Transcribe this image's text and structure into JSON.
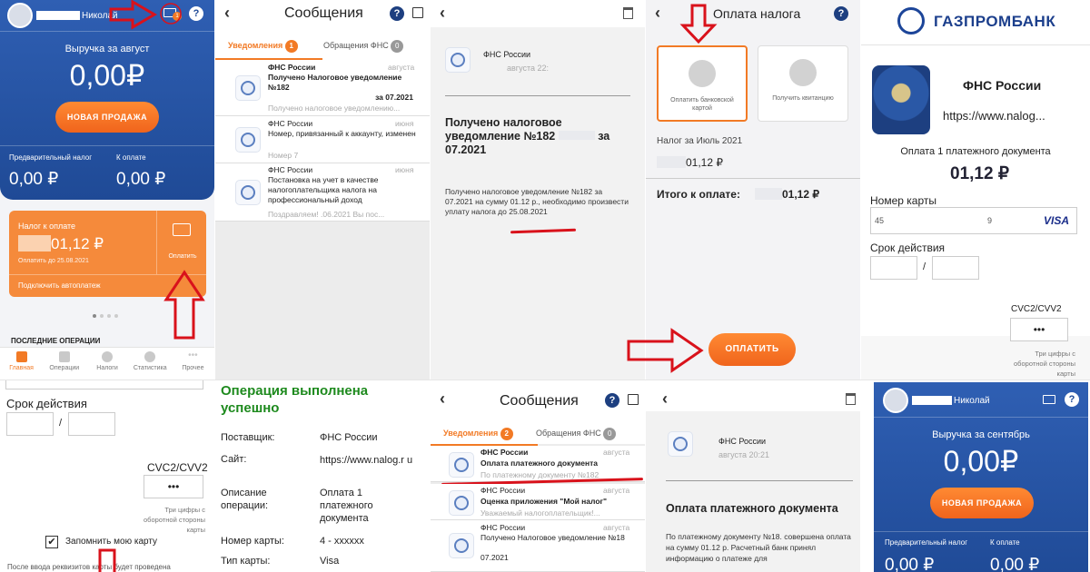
{
  "home": {
    "user_name": "Николай",
    "revenue_label": "Выручка за август",
    "revenue_value": "0,00₽",
    "new_sale": "НОВАЯ ПРОДАЖА",
    "prelim_tax_label": "Предварительный налог",
    "prelim_tax_value": "0,00 ₽",
    "to_pay_label": "К оплате",
    "to_pay_value": "0,00 ₽",
    "tax_card_label": "Налог к оплате",
    "tax_card_value": "01,12 ₽",
    "tax_card_due": "Оплатить до 25.08.2021",
    "pay_label": "Оплатить",
    "autopay": "Подключить автоплатеж",
    "recent_ops": "ПОСЛЕДНИЕ ОПЕРАЦИИ",
    "nav": [
      "Главная",
      "Операции",
      "Налоги",
      "Статистика",
      "Прочее"
    ],
    "mail_badge": "1"
  },
  "messages1": {
    "title": "Сообщения",
    "tab_notifications": "Уведомления",
    "tab_notifications_count": "1",
    "tab_fns": "Обращения ФНС",
    "tab_fns_count": "0",
    "items": [
      {
        "sender": "ФНС России",
        "date": "августа",
        "title": "Получено Налоговое уведомление №182",
        "title2": "за 07.2021",
        "preview": "Получено налоговое уведомлению..."
      },
      {
        "sender": "ФНС России",
        "date": "июня",
        "title": "Номер, привязанный к аккаунту, изменен",
        "title2": "",
        "preview": "Номер 7"
      },
      {
        "sender": "ФНС России",
        "date": "июня",
        "title": "Постановка на учет в качестве налогоплательщика налога на профессиональный доход",
        "title2": "",
        "preview": "Поздравляем!   .06.2021 Вы пос..."
      }
    ]
  },
  "message_detail1": {
    "sender": "ФНС России",
    "date": "августа 22:",
    "heading": "Получено налоговое уведомление №182",
    "heading_suffix": "за 07.2021",
    "body1": "Получено налоговое уведомление №182",
    "body2": "за 07.2021 на сумму",
    "body3": "01.12 р., необходимо произвести уплату налога до",
    "due": "25.08.2021"
  },
  "pay_tax": {
    "title": "Оплата налога",
    "option_card": "Оплатить банковской картой",
    "option_receipt": "Получить квитанцию",
    "tax_label": "Налог за Июль 2021",
    "tax_value": "01,12 ₽",
    "total_label": "Итого к оплате:",
    "total_value": "01,12 ₽",
    "pay_button": "ОПЛАТИТЬ"
  },
  "gpb": {
    "bank_name": "ГАЗПРОМБАНК",
    "merchant": "ФНС России",
    "url": "https://www.nalog...",
    "purpose": "Оплата 1 платежного документа",
    "amount": "01,12 ₽",
    "card_label": "Номер карты",
    "card_value": "45",
    "card_tail": "9",
    "card_brand": "VISA",
    "expiry_label": "Срок действия",
    "cvc_label": "CVC2/CVV2",
    "cvc_value": "•••",
    "cvc_hint": "Три цифры с оборотной стороны карты"
  },
  "gpb_bottom": {
    "expiry_label": "Срок действия",
    "cvc_label": "CVC2/CVV2",
    "cvc_value": "•••",
    "cvc_hint": "Три цифры с оборотной стороны карты",
    "remember": "Запомнить мою карту",
    "footer": "После ввода реквизитов карты будет проведена"
  },
  "success": {
    "title": "Операция выполнена успешно",
    "rows": [
      {
        "k": "Поставщик:",
        "v": "ФНС России"
      },
      {
        "k": "Сайт:",
        "v": "https://www.nalog.r u"
      },
      {
        "k": "Описание операции:",
        "v": "Оплата 1 платежного документа"
      },
      {
        "k": "Номер карты:",
        "v": "4 - xxxxxx"
      },
      {
        "k": "Тип карты:",
        "v": "Visa"
      }
    ]
  },
  "messages2": {
    "title": "Сообщения",
    "tab_notifications": "Уведомления",
    "tab_notifications_count": "2",
    "tab_fns": "Обращения ФНС",
    "tab_fns_count": "0",
    "items": [
      {
        "sender": "ФНС России",
        "date": "августа",
        "title": "Оплата платежного документа",
        "preview": "По платежному документу №182"
      },
      {
        "sender": "ФНС России",
        "date": "августа",
        "title": "Оценка приложения \"Мой налог\"",
        "preview": "Уважаемый налогоплательщик!..."
      },
      {
        "sender": "ФНС России",
        "date": "августа",
        "title": "Получено Налоговое уведомление №18",
        "title2": "07.2021",
        "preview": ""
      }
    ]
  },
  "message_detail2": {
    "sender": "ФНС России",
    "date": "августа 20:21",
    "heading": "Оплата платежного документа",
    "body": "По платежному документу №18.   совершена оплата на сумму   01.12 р. Расчетный банк принял информацию о платеже для"
  },
  "home2": {
    "user_name": "Николай",
    "revenue_label": "Выручка за сентябрь",
    "revenue_value": "0,00₽",
    "new_sale": "НОВАЯ ПРОДАЖА",
    "prelim_tax_label": "Предварительный налог",
    "prelim_tax_value": "0,00 ₽",
    "to_pay_label": "К оплате",
    "to_pay_value": "0,00 ₽"
  },
  "colors": {
    "accent_orange": "#f27a25",
    "brand_blue": "#1f4a96",
    "success_green": "#1e8a1e",
    "arrow_red": "#d9121b"
  }
}
